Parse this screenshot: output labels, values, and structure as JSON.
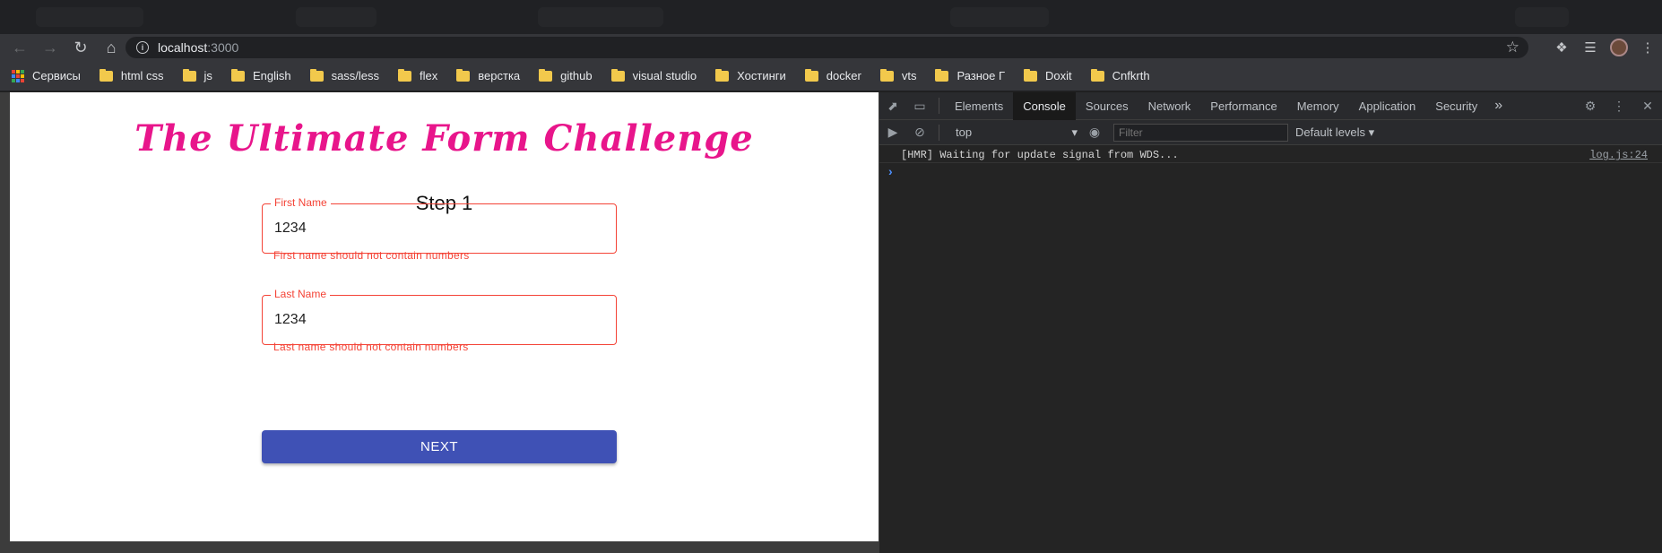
{
  "browser": {
    "url_host": "localhost",
    "url_port": ":3000",
    "bookmarks": [
      {
        "label": "Сервисы",
        "icon": "apps-icon"
      },
      {
        "label": "html css",
        "icon": "folder-icon"
      },
      {
        "label": "js",
        "icon": "folder-icon"
      },
      {
        "label": "English",
        "icon": "folder-icon"
      },
      {
        "label": "sass/less",
        "icon": "folder-icon"
      },
      {
        "label": "flex",
        "icon": "folder-icon"
      },
      {
        "label": "верстка",
        "icon": "folder-icon"
      },
      {
        "label": "github",
        "icon": "folder-icon"
      },
      {
        "label": "visual studio",
        "icon": "folder-icon"
      },
      {
        "label": "Хостинги",
        "icon": "folder-icon"
      },
      {
        "label": "docker",
        "icon": "folder-icon"
      },
      {
        "label": "vts",
        "icon": "folder-icon"
      },
      {
        "label": "Разное Г",
        "icon": "folder-icon"
      },
      {
        "label": "Doxit",
        "icon": "folder-icon"
      },
      {
        "label": "Cnfkrth",
        "icon": "folder-icon"
      }
    ]
  },
  "page": {
    "title": "The Ultimate Form Challenge",
    "step": "Step 1",
    "first_name": {
      "label": "First Name",
      "value": "1234",
      "error": "First name should not contain numbers"
    },
    "last_name": {
      "label": "Last Name",
      "value": "1234",
      "error": "Last name should not contain numbers"
    },
    "next_label": "NEXT"
  },
  "devtools": {
    "tabs": [
      "Elements",
      "Console",
      "Sources",
      "Network",
      "Performance",
      "Memory",
      "Application",
      "Security"
    ],
    "active_tab": "Console",
    "context": "top",
    "filter_placeholder": "Filter",
    "levels": "Default levels",
    "log_message": "[HMR] Waiting for update signal from WDS...",
    "log_source": "log.js:24"
  },
  "colors": {
    "title": "#e8158b",
    "error": "#f44336",
    "button": "#3f51b5"
  }
}
